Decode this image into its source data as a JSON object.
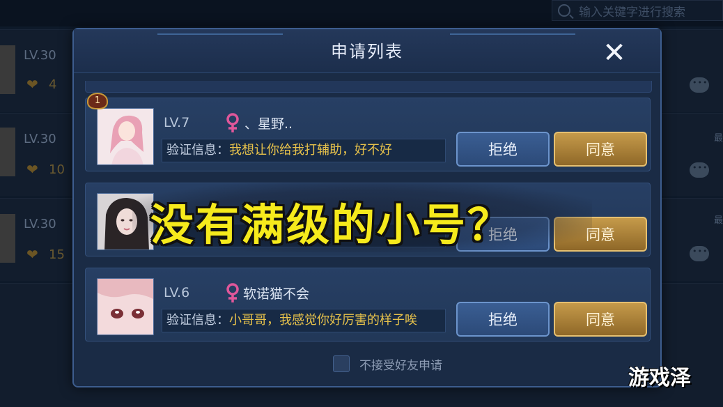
{
  "background": {
    "search_placeholder": "输入关键字进行搜索",
    "rows": [
      {
        "level": "LV.30",
        "count": "4"
      },
      {
        "level": "LV.30",
        "count": "10"
      },
      {
        "level": "LV.30",
        "count": "15"
      }
    ],
    "side_text": "最"
  },
  "dialog": {
    "title": "申请列表",
    "close_label": "✕",
    "requests": [
      {
        "level": "LV.7",
        "nickname": "、星野..",
        "verify_label": "验证信息：",
        "verify_text": "我想让你给我打辅助，好不好",
        "rank_badge": "1",
        "reject_label": "拒绝",
        "agree_label": "同意"
      },
      {
        "level": "",
        "nickname": "",
        "verify_label": "",
        "verify_text": "",
        "reject_label": "拒绝",
        "agree_label": "同意"
      },
      {
        "level": "LV.6",
        "nickname": "软诺猫不会",
        "verify_label": "验证信息：",
        "verify_text": "小哥哥，我感觉你好厉害的样子唉",
        "reject_label": "拒绝",
        "agree_label": "同意"
      }
    ],
    "footer_label": "不接受好友申请"
  },
  "overlay": {
    "headline": "没有满级的小号？",
    "watermark": "游戏泽"
  },
  "colors": {
    "panel": "#1a2b45",
    "border": "#3d5d8e",
    "reject_button": "#2c4a78",
    "agree_button": "#b08a3e",
    "verify_text": "#e7c24b",
    "headline": "#f6ea1c"
  },
  "icons": [
    "search-icon",
    "close-icon",
    "female-icon",
    "heart-icon",
    "chat-icon",
    "rank-badge-icon"
  ]
}
